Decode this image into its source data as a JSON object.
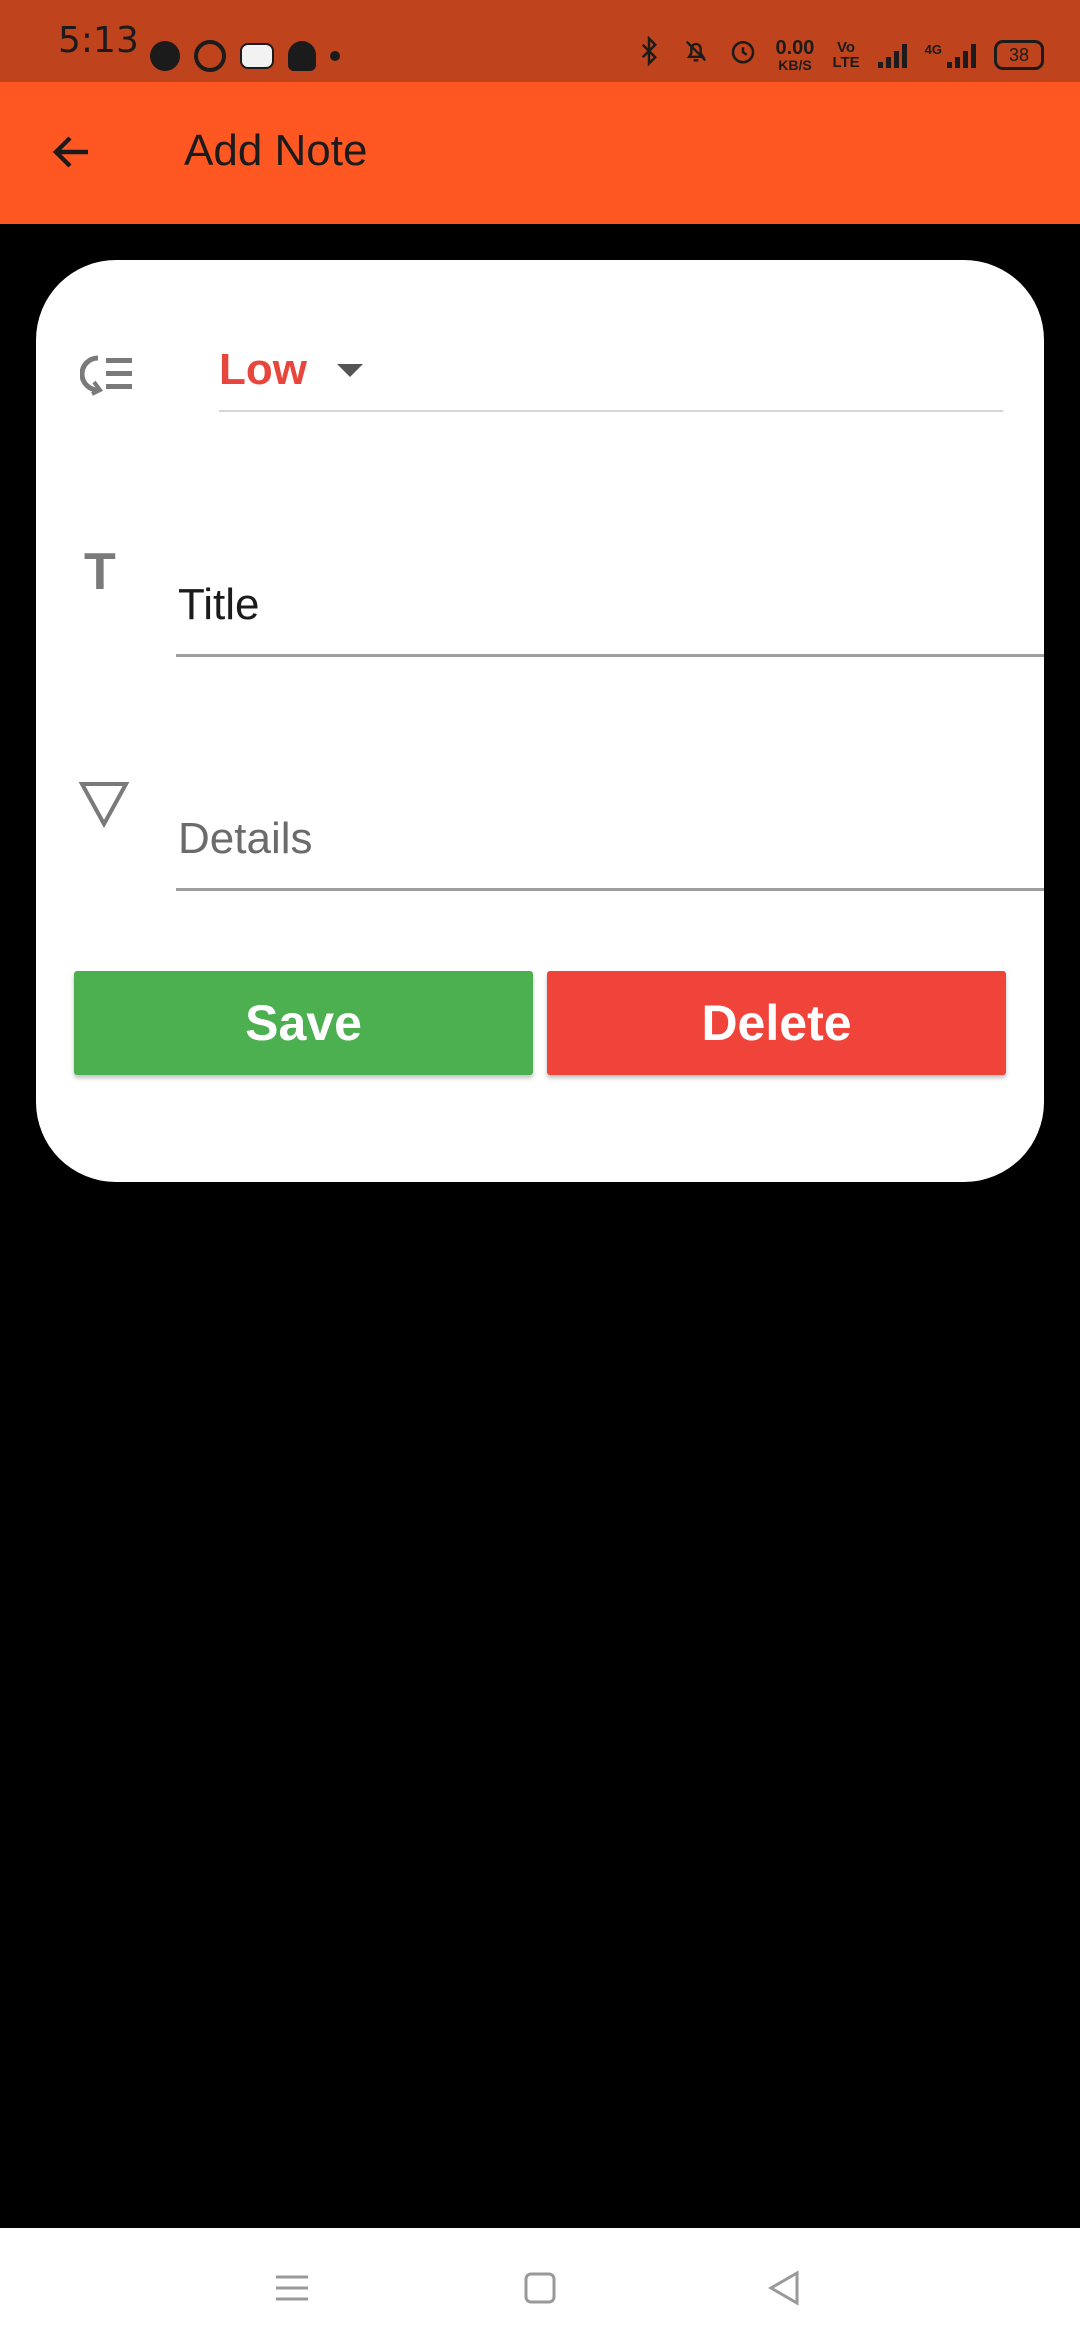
{
  "status_bar": {
    "time": "5:13",
    "left_icons": [
      "spotify-icon",
      "whatsapp-icon",
      "game-controller-icon",
      "snapchat-icon",
      "notification-dot-icon"
    ],
    "right_icons": [
      "bluetooth-icon",
      "mute-bell-icon",
      "alarm-icon"
    ],
    "net_speed_value": "0.00",
    "net_speed_unit": "KB/S",
    "volte_line1": "Vo",
    "volte_line2": "LTE",
    "network_type": "4G",
    "battery": "38"
  },
  "app_bar": {
    "title": "Add Note",
    "back_icon": "arrow-back-icon",
    "color": "#ff5722"
  },
  "form": {
    "priority_icon": "priority-list-icon",
    "priority_value": "Low",
    "priority_color": "#e8453c",
    "title_icon": "text-title-icon",
    "title_placeholder": "Title",
    "details_icon": "triangle-down-icon",
    "details_placeholder": "Details"
  },
  "buttons": {
    "save_label": "Save",
    "save_color": "#4caf50",
    "delete_label": "Delete",
    "delete_color": "#f0433a"
  },
  "nav_bar": {
    "icons": [
      "menu-icon",
      "home-square-icon",
      "back-triangle-icon"
    ]
  }
}
